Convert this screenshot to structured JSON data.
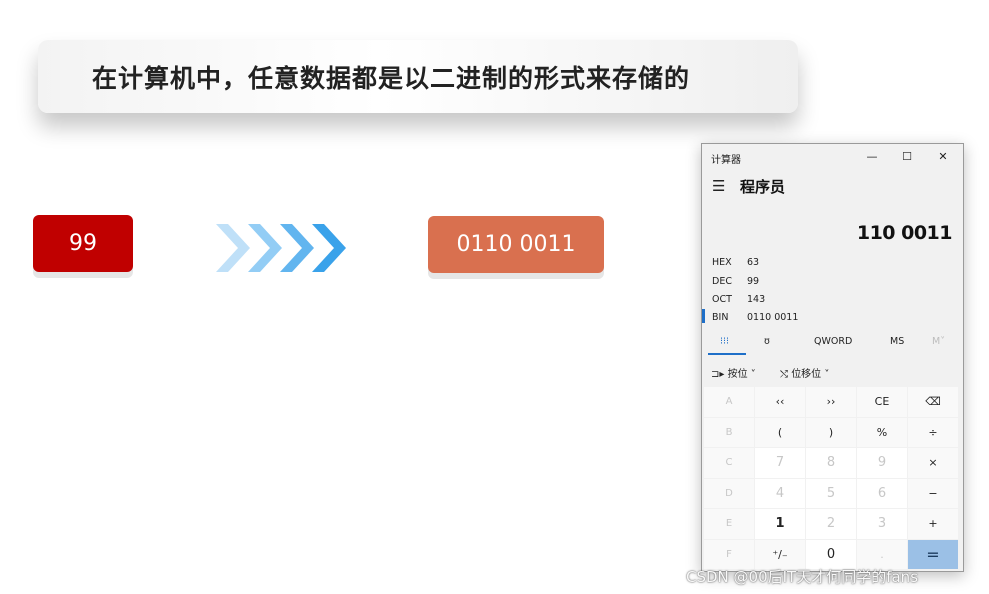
{
  "banner": {
    "text": "在计算机中，任意数据都是以二进制的形式来存储的"
  },
  "decimal_box": {
    "value": "99"
  },
  "binary_box": {
    "value": "0110 0011"
  },
  "arrows": {
    "icon": "chevron-right-icon",
    "count": 4,
    "colors": [
      "#bfe0f8",
      "#93cdf5",
      "#62b5ef",
      "#3aa2ea"
    ]
  },
  "calculator": {
    "window_title": "计算器",
    "window_buttons": {
      "minimize": "—",
      "maximize": "☐",
      "close": "✕"
    },
    "menu_icon": "☰",
    "mode": "程序员",
    "display": "110 0011",
    "radix": [
      {
        "name": "HEX",
        "value": "63"
      },
      {
        "name": "DEC",
        "value": "99"
      },
      {
        "name": "OCT",
        "value": "143"
      },
      {
        "name": "BIN",
        "value": "0110 0011"
      }
    ],
    "selected_radix": "BIN",
    "tabs": {
      "keypad_icon": "⁝⁝⁝",
      "bit_icon": "ʊ",
      "word_size": "QWORD",
      "ms": "MS",
      "m_caret": "M˅"
    },
    "ops": {
      "bitwise_icon": "⊐▸",
      "bitwise": "按位 ˅",
      "shift_icon": "⤭",
      "shift": "位移位 ˅"
    },
    "keys": [
      [
        "A",
        "‹‹",
        "››",
        "CE",
        "⌫"
      ],
      [
        "B",
        "(",
        ")",
        "%",
        "÷"
      ],
      [
        "C",
        "7",
        "8",
        "9",
        "×"
      ],
      [
        "D",
        "4",
        "5",
        "6",
        "−"
      ],
      [
        "E",
        "1",
        "2",
        "3",
        "+"
      ],
      [
        "F",
        "⁺∕₋",
        "0",
        ".",
        "="
      ]
    ]
  },
  "watermark": "CSDN @00后IT天才何同学的fans"
}
